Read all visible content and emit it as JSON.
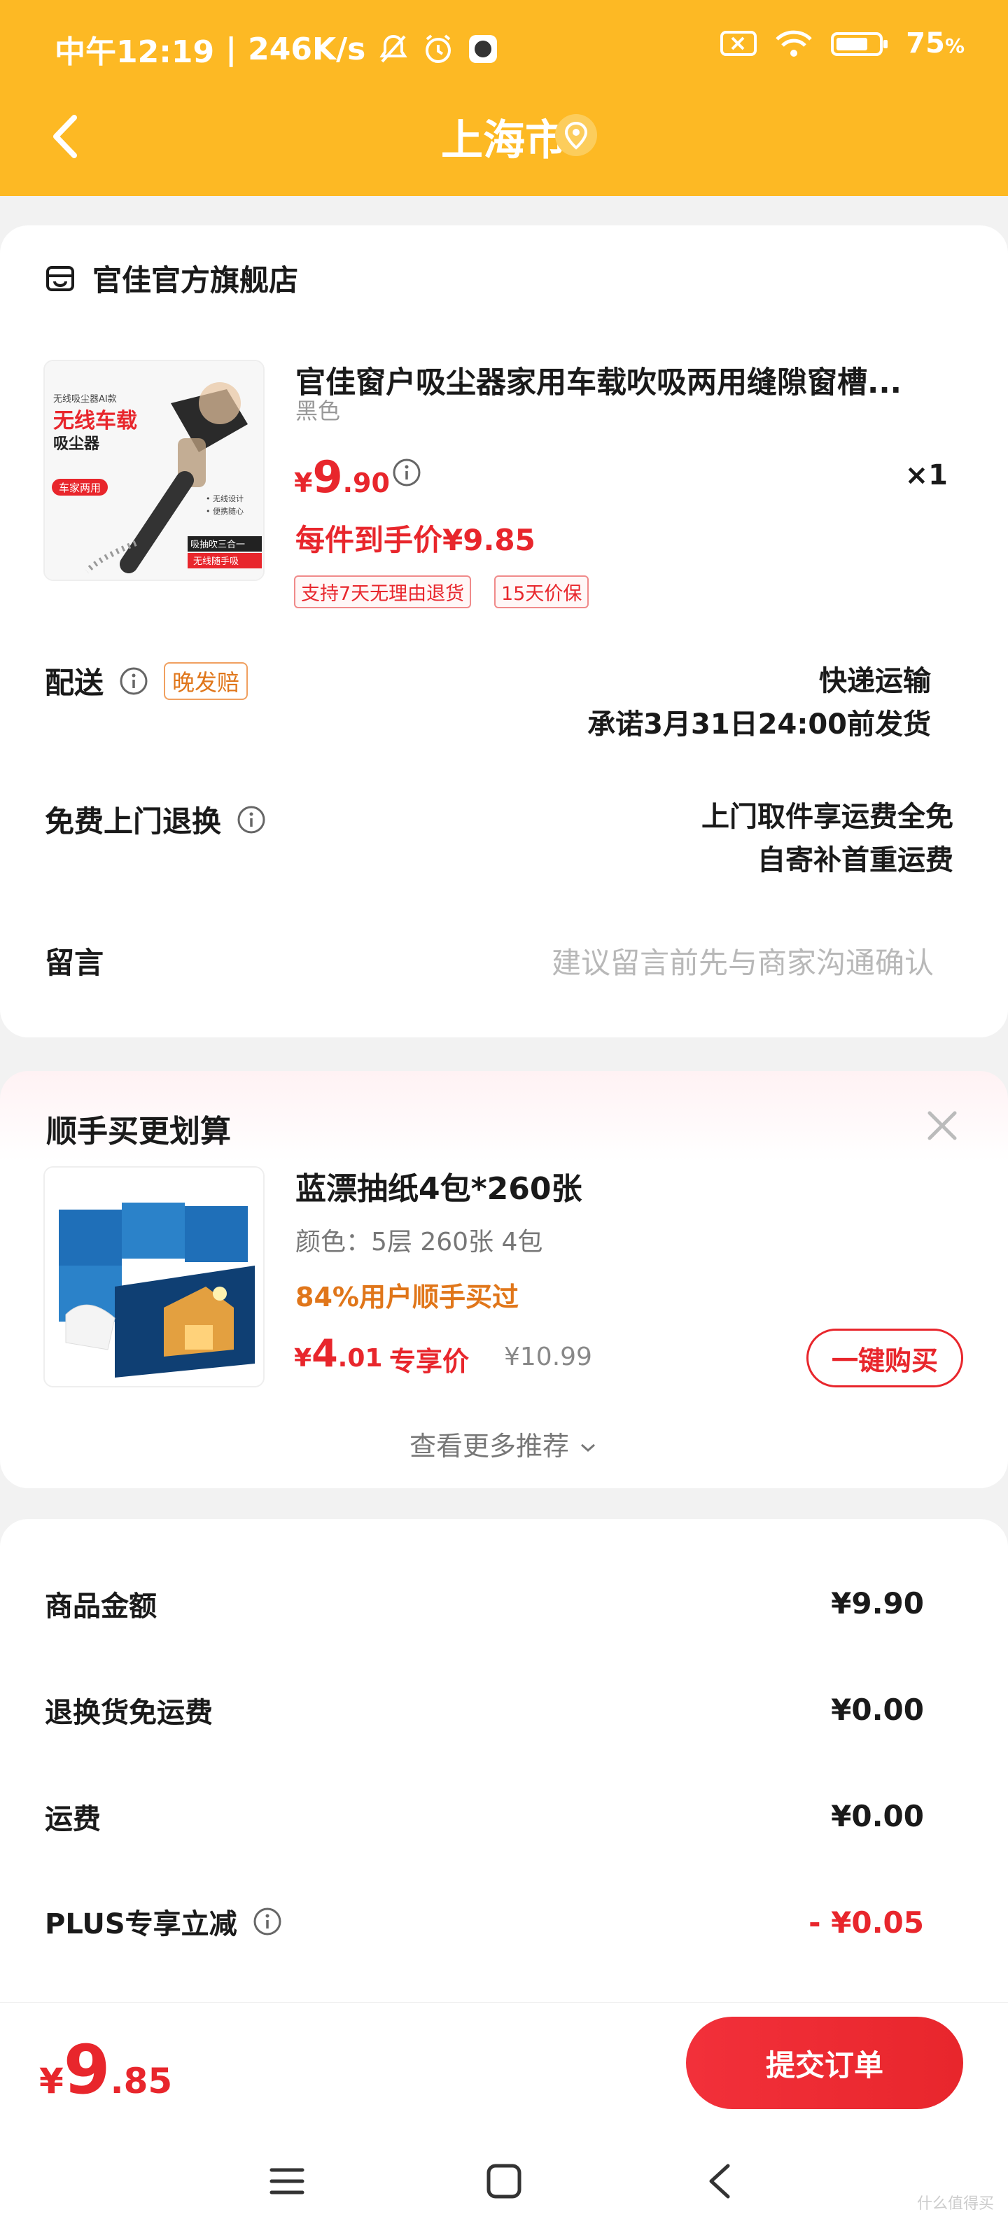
{
  "status_bar": {
    "time": "中午12:19",
    "speed": "246K/s",
    "battery": "75"
  },
  "header": {
    "title": "上海市",
    "colors": {
      "header_bg": "#fdb924",
      "accent": "#e8262c"
    }
  },
  "store": {
    "name": "官佳官方旗舰店"
  },
  "product": {
    "title": "官佳窗户吸尘器家用车载吹吸两用缝隙窗槽...",
    "spec": "黑色",
    "price_currency": "¥",
    "price_int": "9",
    "price_dec": ".90",
    "qty": "×1",
    "hand_price": "每件到手价¥9.85",
    "tags": [
      "支持7天无理由退货",
      "15天价保"
    ],
    "image_text": {
      "brand": "无线吸尘器AI款",
      "headline1": "无线车载",
      "headline2": "吸尘器",
      "badge": "车家两用",
      "feat1": "• 无线设计",
      "feat2": "• 便携随心",
      "bottom1": "吸抽吹三合一",
      "bottom2": "无线随手吸"
    }
  },
  "delivery": {
    "label": "配送",
    "tag": "晚发赔",
    "method": "快递运输",
    "promise": "承诺3月31日24:00前发货"
  },
  "return": {
    "label": "免费上门退换",
    "line1": "上门取件享运费全免",
    "line2": "自寄补首重运费"
  },
  "message": {
    "label": "留言",
    "placeholder": "建议留言前先与商家沟通确认"
  },
  "addon": {
    "title": "顺手买更划算",
    "name": "蓝漂抽纸4包*260张",
    "spec": "颜色：5层 260张 4包",
    "percent": "84%用户顺手买过",
    "price_currency": "¥",
    "price_int": "4",
    "price_dec": ".01",
    "exclusive": "专享价",
    "orig": "¥10.99",
    "buy_btn": "一键购买",
    "more": "查看更多推荐"
  },
  "summary": {
    "items": [
      {
        "label": "商品金额",
        "value": "¥9.90"
      },
      {
        "label": "退换货免运费",
        "value": "¥0.00"
      },
      {
        "label": "运费",
        "value": "¥0.00"
      },
      {
        "label": "PLUS专享立减",
        "value": "- ¥0.05"
      }
    ]
  },
  "footer": {
    "total_currency": "¥",
    "total_int": "9",
    "total_dec": ".85",
    "submit": "提交订单"
  },
  "watermark": "什么值得买"
}
